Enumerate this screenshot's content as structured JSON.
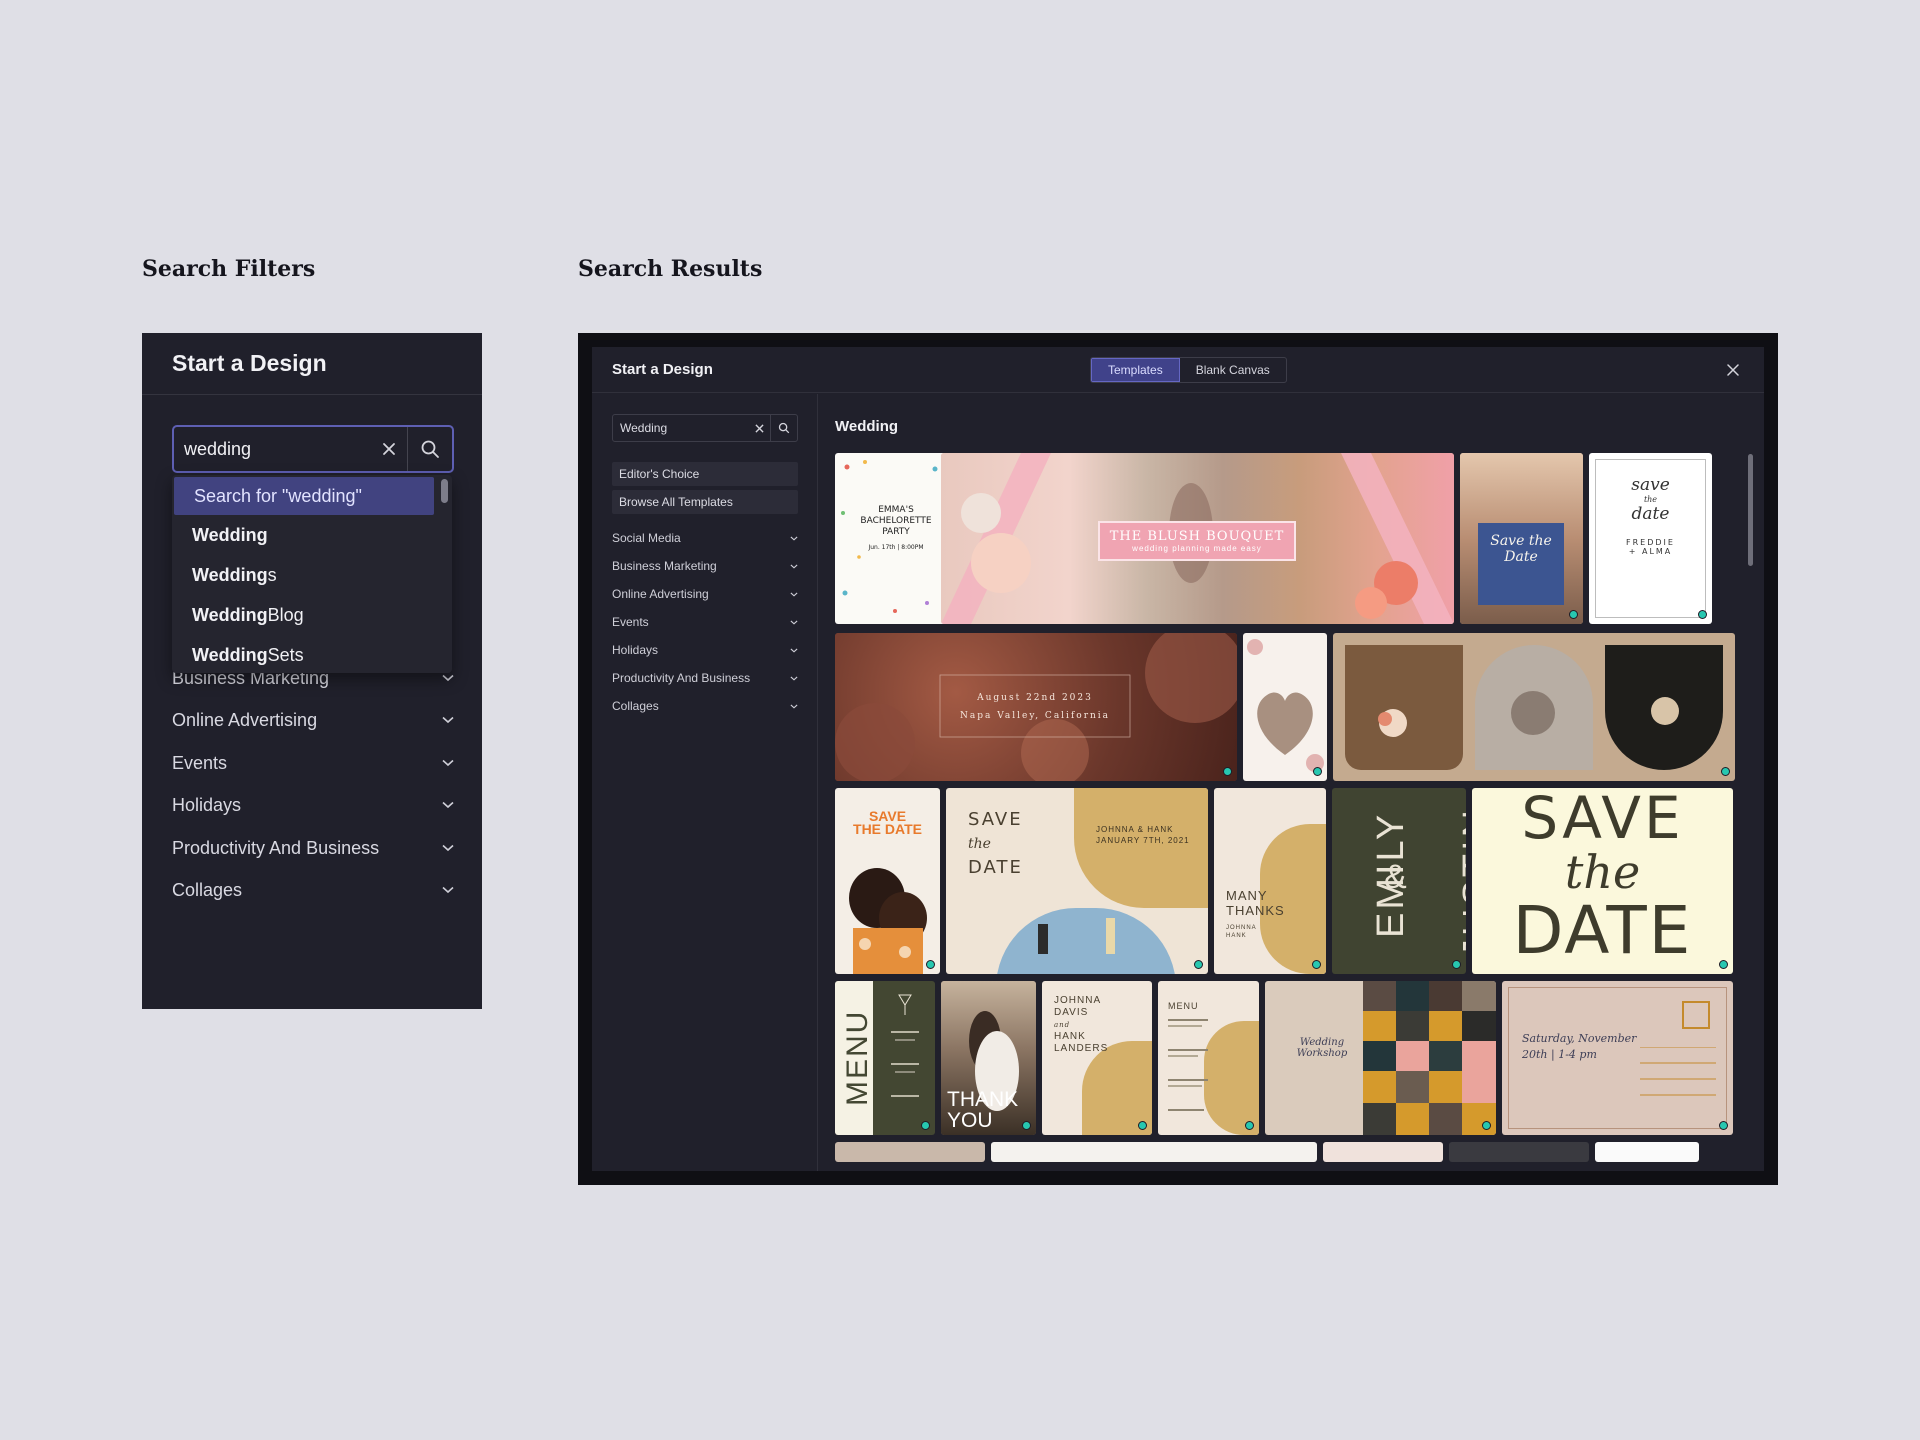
{
  "headings": {
    "filters": "Search Filters",
    "results": "Search Results"
  },
  "left_panel": {
    "title": "Start a Design",
    "search_value": "wedding",
    "dropdown": [
      {
        "bold": "Search for \"wedding\"",
        "rest": ""
      },
      {
        "bold": "Wedding",
        "rest": ""
      },
      {
        "bold": "Wedding",
        "rest": "s"
      },
      {
        "bold": "Wedding",
        "rest": " Blog"
      },
      {
        "bold": "Wedding",
        "rest": " Sets"
      }
    ],
    "categories": [
      "Business Marketing",
      "Online Advertising",
      "Events",
      "Holidays",
      "Productivity And Business",
      "Collages"
    ]
  },
  "modal": {
    "title": "Start a Design",
    "tabs": [
      "Templates",
      "Blank Canvas"
    ],
    "search_value": "Wedding",
    "pills": [
      "Editor's Choice",
      "Browse All Templates"
    ],
    "categories": [
      "Social Media",
      "Business Marketing",
      "Online Advertising",
      "Events",
      "Holidays",
      "Productivity And Business",
      "Collages"
    ],
    "results_title": "Wedding",
    "cards": {
      "emma": [
        "EMMA'S",
        "BACHELORETTE",
        "PARTY",
        "Jun. 17th | 8:00PM"
      ],
      "blush": [
        "THE BLUSH BOUQUET",
        "wedding planning made easy"
      ],
      "savethedate_photo": "Save the Date",
      "save_script": [
        "save",
        "the",
        "date",
        "FREDDIE",
        "+ ALMA"
      ],
      "napa": [
        "August 22nd 2023",
        "Napa Valley, California"
      ],
      "orange_std": [
        "SAVE",
        "THE DATE"
      ],
      "save_the_date_beige": [
        "SAVE",
        "the",
        "DATE",
        "JOHNNA & HANK",
        "JANUARY 7TH, 2021"
      ],
      "many_thanks": [
        "MANY",
        "THANKS",
        "JOHNNA",
        "HANK"
      ],
      "emily": [
        "EMILY",
        "&",
        "JUSTIN"
      ],
      "big_std": [
        "SAVE",
        "the",
        "DATE"
      ],
      "menu_green": "MENU",
      "thank_you": [
        "THANK",
        "YOU"
      ],
      "johnna_davis": [
        "JOHNNA",
        "DAVIS",
        "and",
        "HANK",
        "LANDERS"
      ],
      "menu_small": "MENU",
      "workshop": "Wedding Workshop",
      "saturday": [
        "Saturday, November",
        "20th | 1-4 pm"
      ]
    }
  },
  "colors": {
    "accent": "#5e5fb3",
    "panel_bg": "#20202b",
    "status_dot": "#27c7b0"
  }
}
